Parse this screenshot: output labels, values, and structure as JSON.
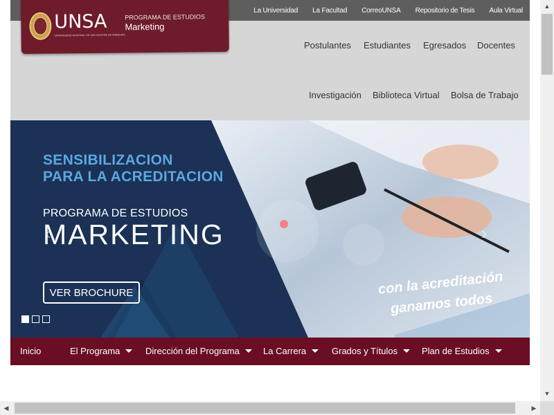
{
  "topbar": {
    "links": [
      "La Universidad",
      "La Facultad",
      "CorreoUNSA",
      "Repositorio de Tesis",
      "Aula Virtual"
    ]
  },
  "brand": {
    "wordmark": "UNSA",
    "subtitle": "UNIVERSIDAD NACIONAL DE SAN AGUSTIN DE AREQUIPA",
    "program_label": "PROGRAMA DE ESTUDIOS",
    "program_name": "Marketing",
    "accent_color": "#6e1b2b"
  },
  "nav_row1": [
    "Postulantes",
    "Estudiantes",
    "Egresados",
    "Docentes"
  ],
  "nav_row2": [
    "Investigación",
    "Biblioteca Virtual",
    "Bolsa de Trabajo"
  ],
  "hero": {
    "title_line1": "SENSIBILIZACION",
    "title_line2": "PARA LA ACREDITACION",
    "program_label": "PROGRAMA DE ESTUDIOS",
    "program_name": "MARKETING",
    "button_label": "VER BROCHURE",
    "slogan_line1": "con la acreditación",
    "slogan_line2": "ganamos todos",
    "prev_icon": "chevron-left-icon",
    "next_icon": "chevron-right-icon",
    "slides_total": 3,
    "active_slide": 1
  },
  "main_nav": {
    "items": [
      {
        "label": "Inicio",
        "dropdown": false
      },
      {
        "label": "El Programa",
        "dropdown": true
      },
      {
        "label": "Dirección del Programa",
        "dropdown": true
      },
      {
        "label": "La Carrera",
        "dropdown": true
      },
      {
        "label": "Grados y Títulos",
        "dropdown": true
      },
      {
        "label": "Plan de Estudios",
        "dropdown": true
      }
    ],
    "background_color": "#6a0e24"
  },
  "scrollbars": {
    "up_icon": "arrow-up-icon",
    "down_icon": "arrow-down-icon",
    "left_icon": "arrow-left-icon",
    "right_icon": "arrow-right-icon"
  }
}
